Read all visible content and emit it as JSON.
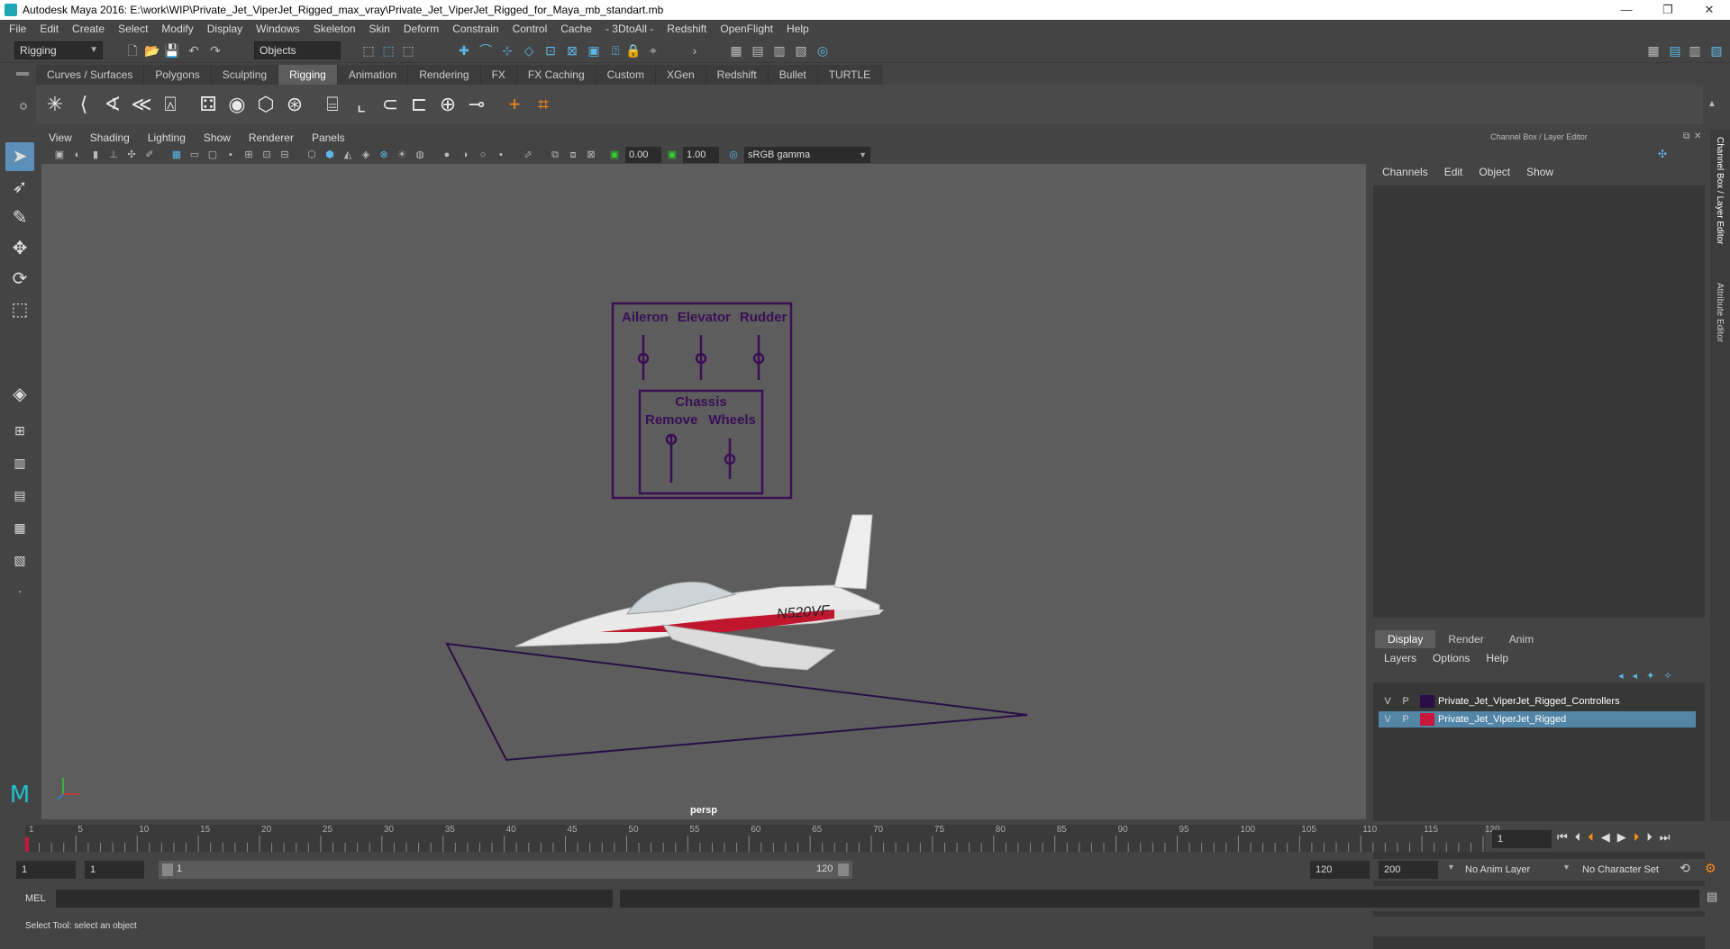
{
  "window": {
    "title": "Autodesk Maya 2016: E:\\work\\WIP\\Private_Jet_ViperJet_Rigged_max_vray\\Private_Jet_ViperJet_Rigged_for_Maya_mb_standart.mb",
    "minimize": "—",
    "restore": "❐",
    "close": "✕"
  },
  "menu": [
    "File",
    "Edit",
    "Create",
    "Select",
    "Modify",
    "Display",
    "Windows",
    "Skeleton",
    "Skin",
    "Deform",
    "Constrain",
    "Control",
    "Cache",
    "- 3DtoAll -",
    "Redshift",
    "OpenFlight",
    "Help"
  ],
  "status_line": {
    "menuset": "Rigging",
    "selection_mode": "Objects"
  },
  "shelf": {
    "tabs": [
      "Curves / Surfaces",
      "Polygons",
      "Sculpting",
      "Rigging",
      "Animation",
      "Rendering",
      "FX",
      "FX Caching",
      "Custom",
      "XGen",
      "Redshift",
      "Bullet",
      "TURTLE"
    ],
    "active_tab": "Rigging"
  },
  "viewport": {
    "menu": [
      "View",
      "Shading",
      "Lighting",
      "Show",
      "Renderer",
      "Panels"
    ],
    "exposure": "0.00",
    "gamma": "1.00",
    "color_space": "sRGB gamma",
    "camera_label": "persp",
    "control_panel": {
      "labels": [
        "Aileron",
        "Elevator",
        "Rudder"
      ],
      "chassis_title": "Chassis",
      "chassis_labels": [
        "Remove",
        "Wheels"
      ]
    },
    "registration": "N520VF"
  },
  "channel_box": {
    "title": "Channel Box / Layer Editor",
    "menu": [
      "Channels",
      "Edit",
      "Object",
      "Show"
    ]
  },
  "layer_editor": {
    "tabs": [
      "Display",
      "Render",
      "Anim"
    ],
    "active_tab": "Display",
    "menu": [
      "Layers",
      "Options",
      "Help"
    ],
    "layers": [
      {
        "v": "V",
        "p": "P",
        "name": "Private_Jet_ViperJet_Rigged_Controllers",
        "color": "#2a0f44",
        "selected": false
      },
      {
        "v": "V",
        "p": "P",
        "name": "Private_Jet_ViperJet_Rigged",
        "color": "#c8173d",
        "selected": true
      }
    ]
  },
  "side_tabs": [
    "Channel Box / Layer Editor",
    "Attribute Editor"
  ],
  "time_slider": {
    "ticks": [
      "1",
      "5",
      "10",
      "15",
      "20",
      "25",
      "30",
      "35",
      "40",
      "45",
      "50",
      "55",
      "60",
      "65",
      "70",
      "75",
      "80",
      "85",
      "90",
      "95",
      "100",
      "105",
      "110",
      "115",
      "120"
    ],
    "current_frame": "1"
  },
  "range_slider": {
    "start": "1",
    "playback_start": "1",
    "range_label_start": "1",
    "range_label_end": "120",
    "playback_end": "120",
    "end": "200",
    "anim_layer": "No Anim Layer",
    "character_set": "No Character Set"
  },
  "command_line": {
    "label": "MEL"
  },
  "help_line": "Select Tool: select an object"
}
